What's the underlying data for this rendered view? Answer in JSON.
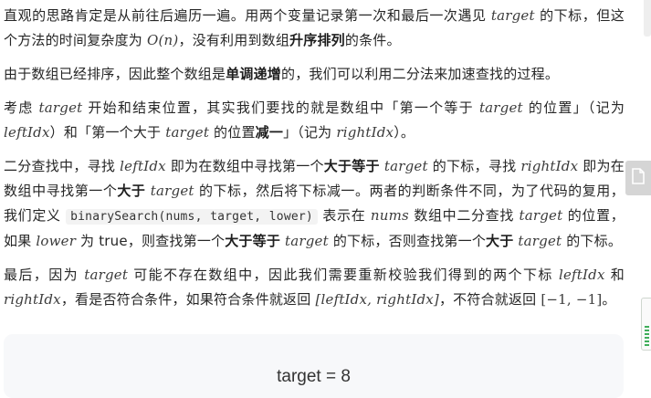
{
  "paragraphs": {
    "p1": {
      "t1": "直观的思路肯定是从前往后遍历一遍。用两个变量记录第一次和最后一次遇见 ",
      "m1": "target",
      "t2": " 的下标，但这个方法的时间复杂度为 ",
      "m2": "O(n)",
      "t3": "，没有利用到数组",
      "b1": "升序排列",
      "t4": "的条件。"
    },
    "p2": {
      "t1": "由于数组已经排序，因此整个数组是",
      "b1": "单调递增",
      "t2": "的，我们可以利用二分法来加速查找的过程。"
    },
    "p3": {
      "t1": "考虑 ",
      "m1": "target",
      "t2": " 开始和结束位置，其实我们要找的就是数组中「第一个等于 ",
      "m2": "target",
      "t3": " 的位置」（记为 ",
      "m3": "leftIdx",
      "t4": "）和「第一个大于 ",
      "m4": "target",
      "t5": " 的位置",
      "b1": "减一",
      "t6": "」（记为 ",
      "m5": "rightIdx",
      "t7": "）。"
    },
    "p4": {
      "t1": "二分查找中，寻找 ",
      "m1": "leftIdx",
      "t2": " 即为在数组中寻找第一个",
      "b1": "大于等于",
      "t3": " ",
      "m2": "target",
      "t4": " 的下标，寻找 ",
      "m3": "rightIdx",
      "t5": " 即为在数组中寻找第一个",
      "b2": "大于",
      "t6": " ",
      "m4": "target",
      "t7": " 的下标，然后将下标减一。两者的判断条件不同，为了代码的复用，我们定义 ",
      "code1": "binarySearch(nums, target, lower)",
      "t8": " 表示在 ",
      "m5": "nums",
      "t9": " 数组中二分查找 ",
      "m6": "target",
      "t10": " 的位置，如果 ",
      "m7": "lower",
      "t11": " 为 true，则查找第一个",
      "b3": "大于等于",
      "t12": " ",
      "m8": "target",
      "t13": " 的下标，否则查找第一个",
      "b4": "大于",
      "t14": " ",
      "m9": "target",
      "t15": " 的下标。"
    },
    "p5": {
      "t1": "最后，因为 ",
      "m1": "target",
      "t2": " 可能不存在数组中，因此我们需要重新校验我们得到的两个下标 ",
      "m2": "leftIdx",
      "t3": " 和 ",
      "m3": "rightIdx",
      "t4": "，看是否符合条件，如果符合条件就返回 ",
      "m4": "[leftIdx, rightIdx]",
      "t5": "，不符合就返回 ",
      "m5": "[−1, −1]",
      "t6": "。"
    }
  },
  "figure": {
    "title": "target = 8"
  },
  "icons": {
    "float_button": "document-icon",
    "side_widget": "signal-bars-icon"
  }
}
